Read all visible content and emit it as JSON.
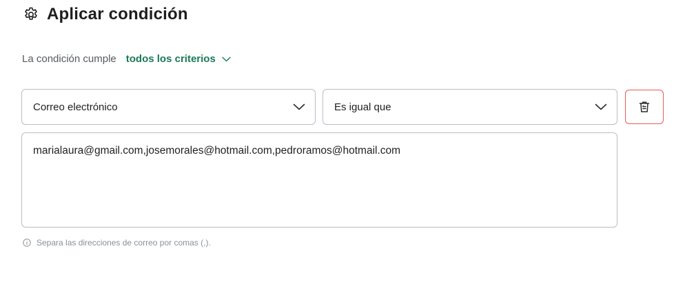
{
  "header": {
    "title": "Aplicar condición",
    "icon": "gear-icon"
  },
  "criteria": {
    "label": "La condición cumple",
    "selected": "todos los criterios",
    "accent": "#1a7a56"
  },
  "condition": {
    "field": {
      "value": "Correo electrónico"
    },
    "operator": {
      "value": "Es igual que"
    },
    "delete_icon": "trash-icon",
    "delete_color": "#e55a5a",
    "value_text": "marialaura@gmail.com,josemorales@hotmail.com,pedroramos@hotmail.com",
    "hint": "Separa las direcciones de correo por comas (,)."
  }
}
